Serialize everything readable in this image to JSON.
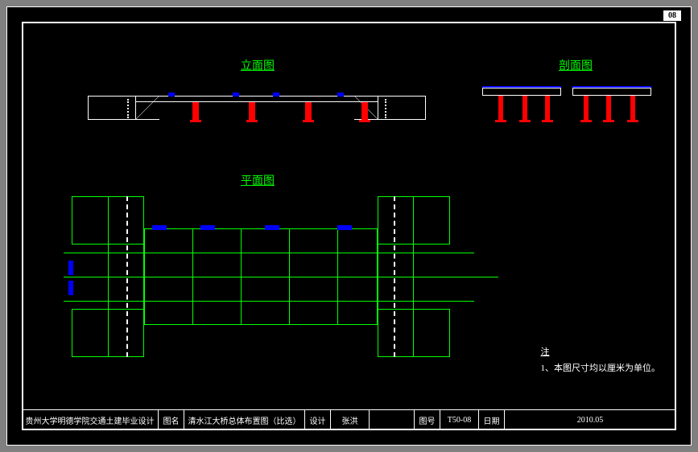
{
  "sheet_number_top": "08",
  "views": {
    "elevation_title": "立面图",
    "section_title": "剖面图",
    "plan_title": "平面图"
  },
  "notes": {
    "header": "注",
    "item1": "1、本图尺寸均以厘米为单位。"
  },
  "titleblock": {
    "organization": "贵州大学明德学院交通土建毕业设计",
    "name_label": "图名",
    "drawing_title": "清水江大桥总体布置图（比选）",
    "design_label": "设计",
    "designer": "张洪",
    "logo_text": "",
    "number_label": "图号",
    "drawing_number": "T50-08",
    "date_label": "日期",
    "date": "2010.05"
  },
  "colors": {
    "frame": "#ffffff",
    "structure": "#00ff00",
    "piers": "#ff0000",
    "bearings": "#0000ff",
    "background": "#000000"
  }
}
